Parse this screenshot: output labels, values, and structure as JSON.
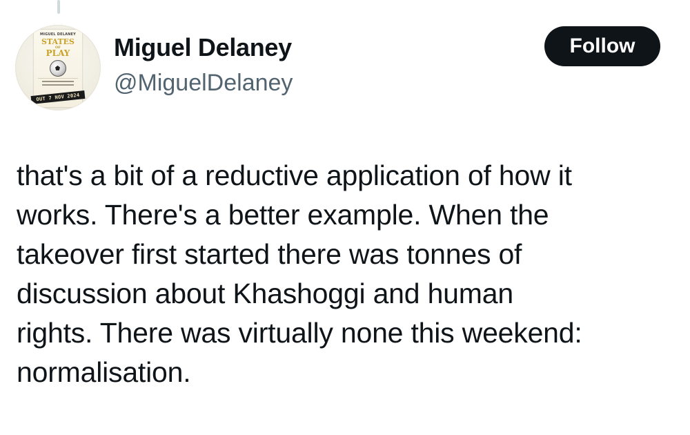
{
  "tweet": {
    "author": {
      "display_name": "Miguel Delaney",
      "handle": "@MiguelDelaney",
      "avatar": {
        "icon": "book-cover-avatar",
        "book_author": "MIGUEL DELANEY",
        "book_title_line1": "STATES",
        "book_title_line2": "OF",
        "book_title_line3": "PLAY",
        "band_text": "OUT 7 NOV 2024"
      }
    },
    "follow_label": "Follow",
    "text": "that's a bit of a reductive application of how it\nworks. There's a better example. When the\ntakeover first started there was tonnes of\ndiscussion about Khashoggi and human\nrights. There was virtually none this weekend:\nnormalisation."
  },
  "colors": {
    "text_primary": "#0f1419",
    "text_secondary": "#536471",
    "button_bg": "#0f1419",
    "button_text": "#ffffff",
    "thread_line": "#cfd9de",
    "book_title_gold": "#c9a227"
  }
}
